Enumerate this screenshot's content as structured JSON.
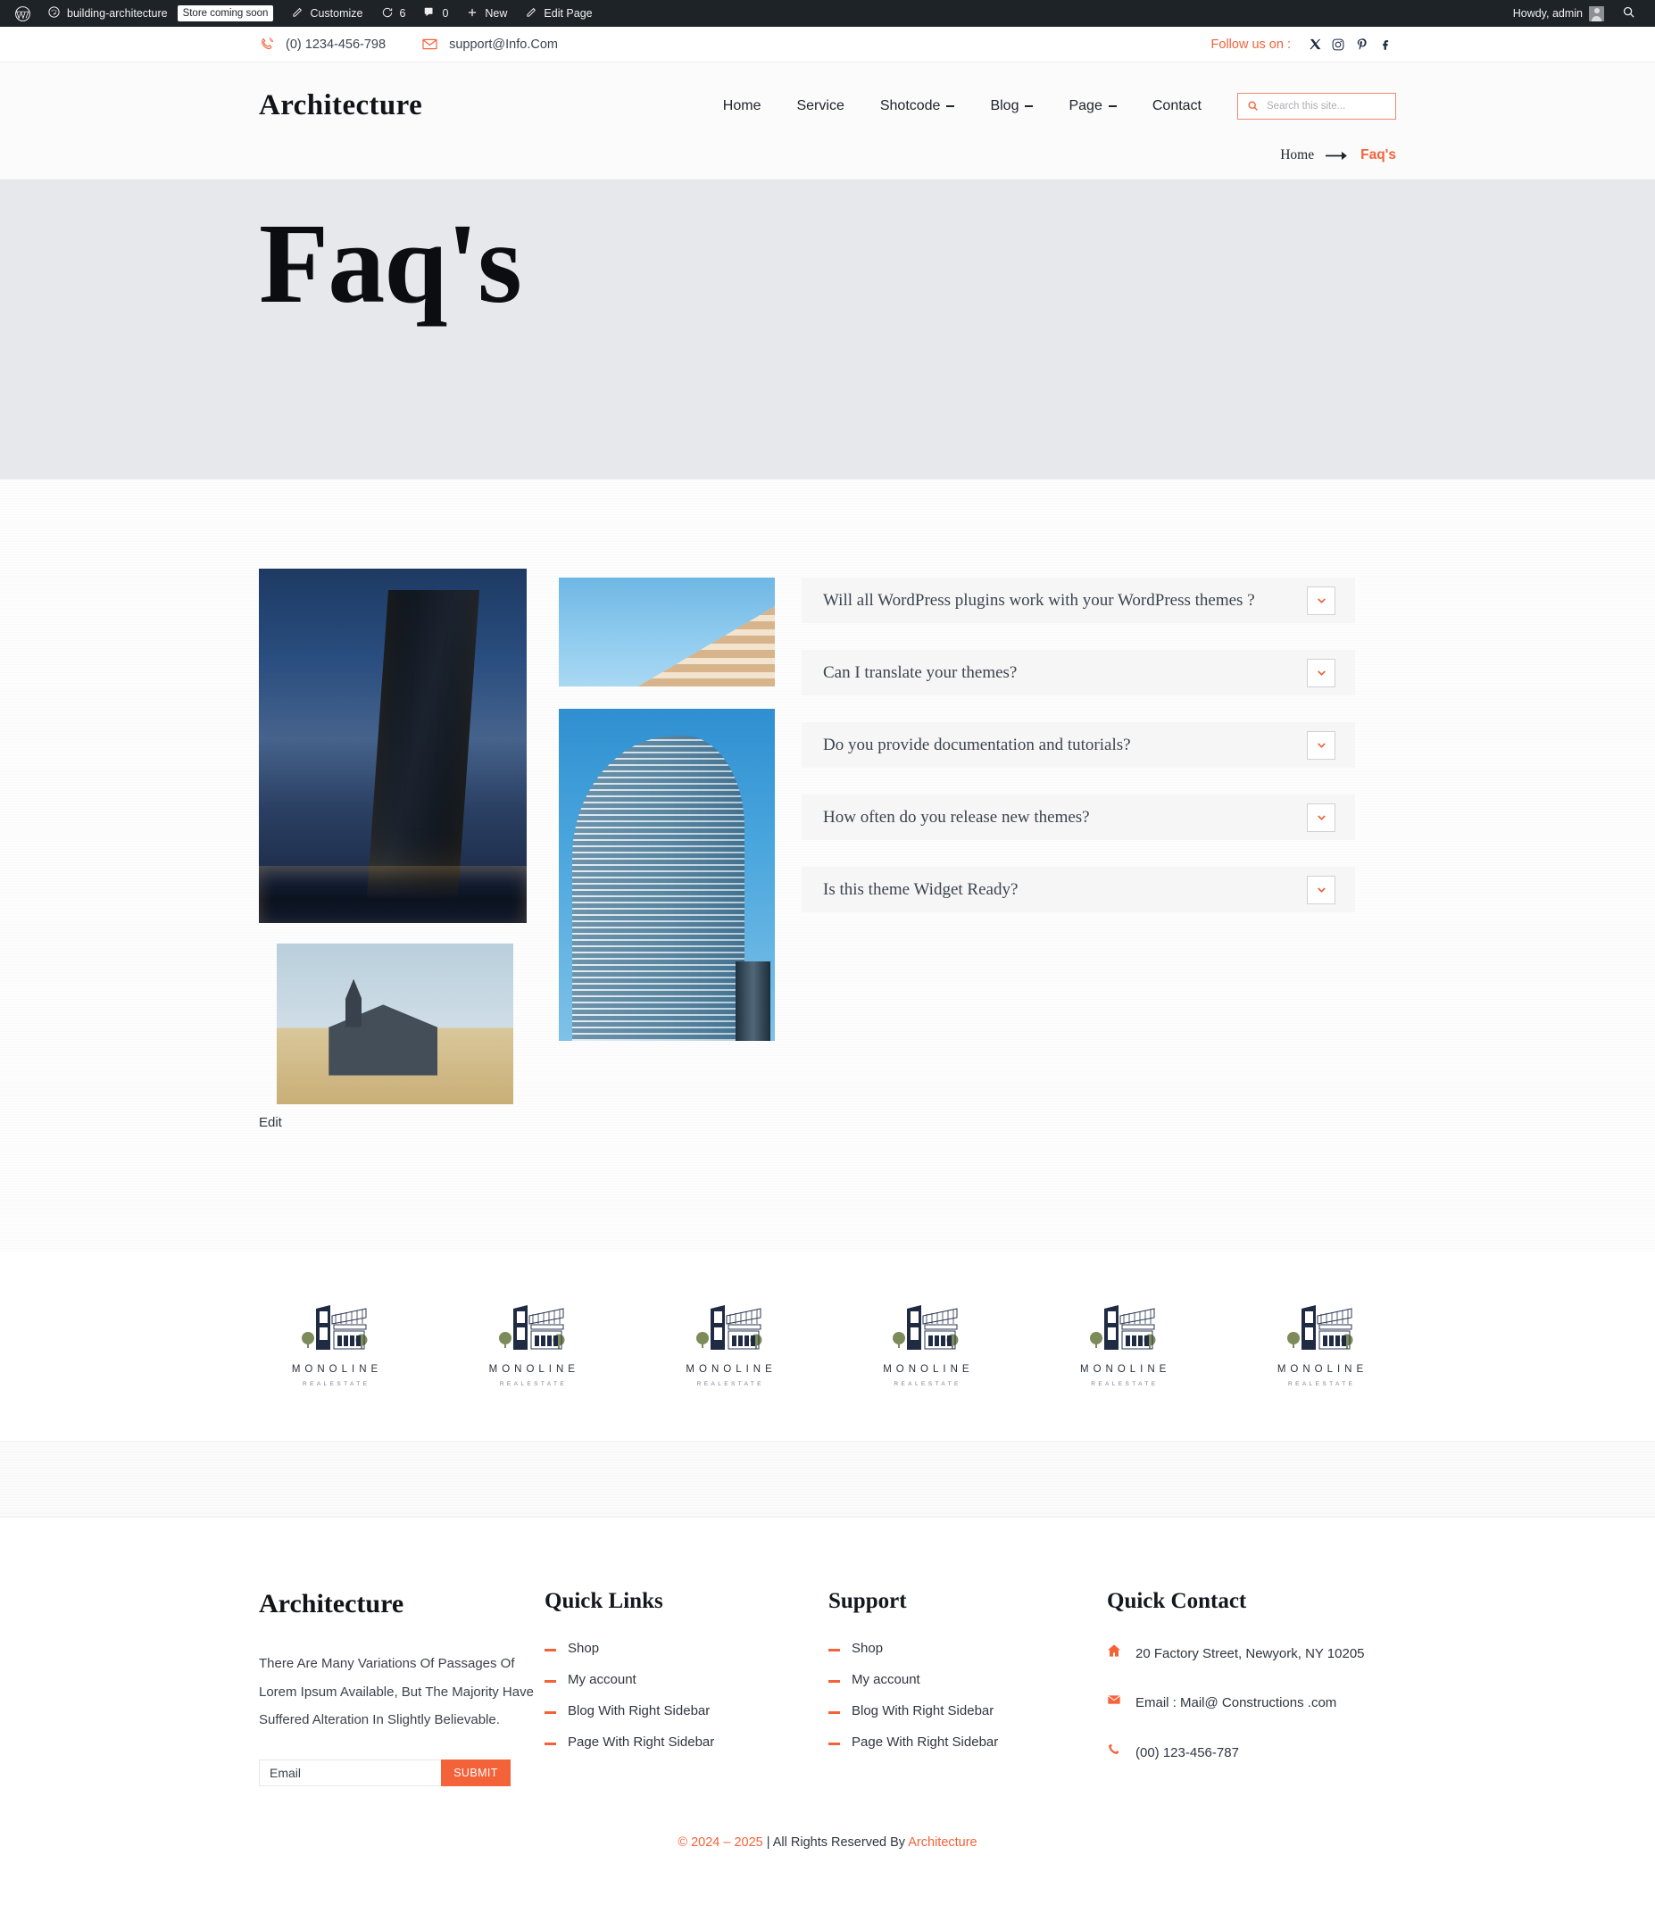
{
  "adminbar": {
    "wp_logo": "wordpress-logo-icon",
    "site_name": "building-architecture",
    "store_badge": "Store coming soon",
    "customize": "Customize",
    "updates_count": "6",
    "comments_count": "0",
    "new_label": "New",
    "edit_page": "Edit Page",
    "howdy": "Howdy, admin",
    "search_icon": "search-icon"
  },
  "topbar": {
    "phone": "(0) 1234-456-798",
    "email": "support@Info.Com",
    "follow_label": "Follow us on :",
    "socials": [
      {
        "name": "x-twitter-icon"
      },
      {
        "name": "instagram-icon"
      },
      {
        "name": "pinterest-icon"
      },
      {
        "name": "facebook-icon"
      }
    ]
  },
  "header": {
    "brand": "Architecture",
    "nav": [
      {
        "label": "Home",
        "has_caret": false
      },
      {
        "label": "Service",
        "has_caret": false
      },
      {
        "label": "Shotcode",
        "has_caret": true
      },
      {
        "label": "Blog",
        "has_caret": true
      },
      {
        "label": "Page",
        "has_caret": true
      },
      {
        "label": "Contact",
        "has_caret": false
      }
    ],
    "search_placeholder": "Search this site...",
    "search_value": ""
  },
  "breadcrumb": {
    "home": "Home",
    "current": "Faq's"
  },
  "hero": {
    "title": "Faq's"
  },
  "gallery": {
    "edit_label": "Edit",
    "images": [
      {
        "name": "photo-dark-glass-tower"
      },
      {
        "name": "photo-terraced-hotel"
      },
      {
        "name": "photo-curved-glass-tower"
      },
      {
        "name": "photo-black-church"
      }
    ]
  },
  "faq": {
    "items": [
      {
        "question": "Will all WordPress plugins work with your WordPress themes ?"
      },
      {
        "question": "Can I translate your themes?"
      },
      {
        "question": "Do you provide documentation and tutorials?"
      },
      {
        "question": "How often do you release new themes?"
      },
      {
        "question": "Is this theme Widget Ready?"
      }
    ]
  },
  "clients": {
    "logos": [
      {
        "name": "MONOLINE",
        "sub": "REALESTATE"
      },
      {
        "name": "MONOLINE",
        "sub": "REALESTATE"
      },
      {
        "name": "MONOLINE",
        "sub": "REALESTATE"
      },
      {
        "name": "MONOLINE",
        "sub": "REALESTATE"
      },
      {
        "name": "MONOLINE",
        "sub": "REALESTATE"
      },
      {
        "name": "MONOLINE",
        "sub": "REALESTATE"
      }
    ]
  },
  "footer": {
    "brand": "Architecture",
    "description": "There Are Many Variations Of Passages Of Lorem Ipsum Available, But The Majority Have Suffered Alteration In Slightly Believable.",
    "email_placeholder": "Email",
    "email_value": "",
    "submit_label": "SUBMIT",
    "quick_links": {
      "title": "Quick Links",
      "items": [
        {
          "label": "Shop"
        },
        {
          "label": "My account"
        },
        {
          "label": "Blog With Right Sidebar"
        },
        {
          "label": "Page With Right Sidebar"
        }
      ]
    },
    "support": {
      "title": "Support",
      "items": [
        {
          "label": "Shop"
        },
        {
          "label": "My account"
        },
        {
          "label": "Blog With Right Sidebar"
        },
        {
          "label": "Page With Right Sidebar"
        }
      ]
    },
    "quick_contact": {
      "title": "Quick Contact",
      "items": [
        {
          "icon": "home-icon",
          "text": "20 Factory Street, Newyork, NY 10205"
        },
        {
          "icon": "envelope-icon",
          "text": "Email : Mail@ Constructions .com"
        },
        {
          "icon": "phone-icon",
          "text": "(00) 123-456-787"
        }
      ]
    }
  },
  "copyright": {
    "years": "© 2024 – 2025",
    "middle": " | All Rights Reserved By ",
    "brand": "Architecture"
  },
  "colors": {
    "accent": "#f4623a",
    "adminbar": "#1d2327",
    "hero_bg": "#e7e8ec",
    "faq_item_bg": "#f6f6f6"
  }
}
